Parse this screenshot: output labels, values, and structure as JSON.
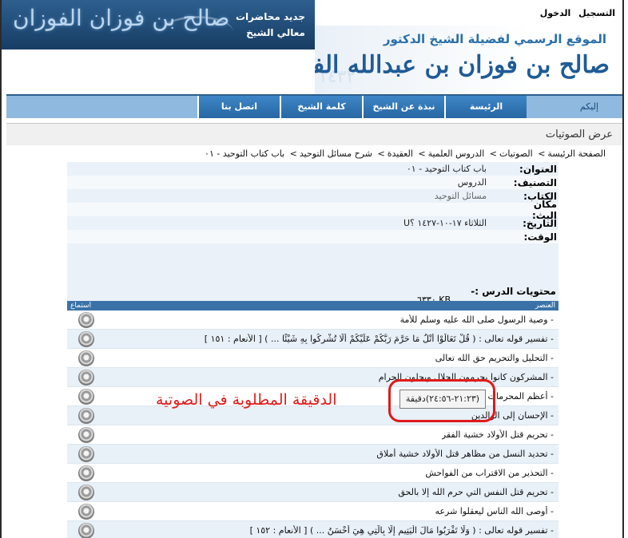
{
  "top_links": {
    "register": "التسجيل",
    "login": "الدخول"
  },
  "ad_banner": {
    "logo_text": "صالح بن فوزان الفوزان",
    "line1": "جديد محاضرات",
    "line2": "معالي الشيخ"
  },
  "site_header": {
    "subtitle": "الموقع الرسمي لفضيلة الشيخ الدكتور",
    "name": "صالح بن فوزان بن عبدالله الفوزان"
  },
  "nav": {
    "items": [
      {
        "label": "إليكم"
      },
      {
        "label": "الرئيسة"
      },
      {
        "label": "نبذة عن الشيخ"
      },
      {
        "label": "كلمة الشيخ"
      },
      {
        "label": "اتصل بنا"
      }
    ]
  },
  "page": {
    "title": "عرض الصوتيات",
    "breadcrumb": [
      "الصفحة الرئيسة",
      "الصوتيات",
      "الدروس العلمية",
      "العقيدة",
      "شرح مسائل التوحيد",
      "باب كتاب التوحيد - ٠١"
    ],
    "breadcrumb_sep": ">"
  },
  "details": [
    {
      "label": "العنوان:",
      "value": "باب كتاب التوحيد - ٠١"
    },
    {
      "label": "التصنيف:",
      "value": "الدروس"
    },
    {
      "label": "الكتاب:",
      "value": "مسائل التوحيد"
    },
    {
      "label": "مكان البث:",
      "value": ""
    },
    {
      "label": "التاريخ:",
      "value": "الثلاثاء ١٧-١٠-١٤٢٧ ؟U"
    },
    {
      "label": "الوقت:",
      "value": ""
    }
  ],
  "size": "KB ٦٣٣٠",
  "contents_title": "محتويات الدرس :-",
  "table": {
    "col_item": "العنصر",
    "col_listen": "استماع",
    "rows": [
      "- وصية الرسول صلى الله عليه وسلم للأمة",
      "- تفسير قوله تعالى : ( قُلْ تَعَالَوْا أَتْلُ مَا حَرَّمَ رَبُّكُمْ عَلَيْكُمْ أَلَّا تُشْرِكُوا بِهِ شَيْئًا ... ) [ الأنعام : ١٥١ ]",
      "- التحليل والتحريم حق الله تعالى",
      "- المشركون كانوا يحرمون الحلال ويحلون الحرام",
      "- أعظم المحرمات",
      "- الإحسان إلى الوالدين",
      "- تحريم قتل الأولاد خشية الفقر",
      "- تحديد النسل من مظاهر قتل الأولاد خشية أملاق",
      "- التحذير من الاقتراب من الفواحش",
      "- تحريم قتل النفس التي حرم الله إلا بالحق",
      "- أوصى الله الناس ليعقلوا شرعه",
      "- تفسير قوله تعالى : ( وَلَا تَقْرَبُوا مَالَ الْيَتِيمِ إِلَّا بِالَّتِي هِيَ أَحْسَنُ ... ) [ الأنعام : ١٥٢ ]"
    ]
  },
  "tooltip": "(٢١:٢٣-٢٤:٥٦)دقيقة",
  "annotation": "الدقيقة المطلوبة في الصوتية",
  "colors": {
    "nav_blue": "#2766a3",
    "annotation_red": "#e01a1a",
    "row_alt": "#e8f0f8"
  }
}
